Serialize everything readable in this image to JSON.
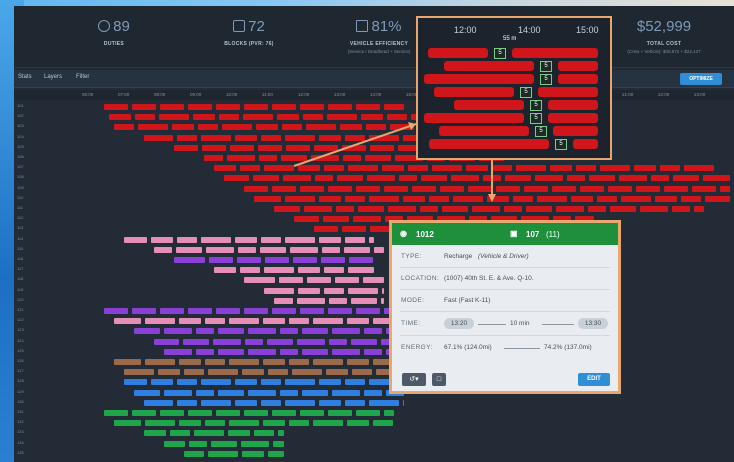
{
  "stats": [
    {
      "value": "89",
      "label": "DUTIES",
      "sub": ""
    },
    {
      "value": "72",
      "label": "BLOCKS (PVR: 76)",
      "sub": ""
    },
    {
      "value": "81%",
      "label": "VEHICLE EFFICIENCY",
      "sub": "(Service / Deadhead + Service)"
    },
    {
      "value": "$52,999",
      "label": "TOTAL COST",
      "sub": "(Crew + Vehicle): $30,872 + $22,127"
    }
  ],
  "toolbar": {
    "stats": "Stats",
    "layers": "Layers",
    "filter": "Filter",
    "optimize": "OPTIMIZE"
  },
  "timeline": [
    "06:00",
    "07:00",
    "08:00",
    "09:00",
    "10:00",
    "11:00",
    "12:00",
    "13:00",
    "14:00",
    "15:00",
    "16:00",
    "17:00",
    "18:00",
    "19:00",
    "20:00",
    "21:00",
    "22:00",
    "23:00"
  ],
  "row_ids": [
    "101",
    "102",
    "103",
    "104",
    "105",
    "106",
    "107",
    "108",
    "109",
    "110",
    "111",
    "112",
    "113",
    "114",
    "115",
    "116",
    "117",
    "118",
    "119",
    "120",
    "121",
    "122",
    "123",
    "124",
    "125",
    "126",
    "127",
    "128",
    "129",
    "130",
    "131",
    "132",
    "133",
    "134",
    "135"
  ],
  "zoom": {
    "times": [
      "12:00",
      "14:00",
      "15:00"
    ],
    "duration": "55 m",
    "labels": [
      "5",
      "5",
      "5",
      "5",
      "5",
      "5",
      "5",
      "5",
      "11",
      "11",
      "11"
    ]
  },
  "details": {
    "driver_id": "1012",
    "block_id": "107",
    "block_count": "(11)",
    "type_label": "TYPE:",
    "type_value": "Recharge",
    "type_note": "(Vehicle & Driver)",
    "location_label": "LOCATION:",
    "location_value": "(1007) 40th St. E. & Ave. Q-10.",
    "mode_label": "MODE:",
    "mode_value": "Fast (Fast K-11)",
    "time_label": "TIME:",
    "time_start": "13:20",
    "time_duration": "10 min",
    "time_end": "13:30",
    "energy_label": "ENERGY:",
    "energy_start": "67.1% (124.0mi)",
    "energy_end": "74.2% (137.0mi)",
    "edit": "EDIT"
  },
  "colors": {
    "red": "#d0151b",
    "pink": "#e58fb7",
    "purple": "#8a3fd6",
    "brown": "#9a6a4a",
    "blue": "#2e7fe0",
    "green": "#1fa54a",
    "highlight": "#e8a76e"
  }
}
